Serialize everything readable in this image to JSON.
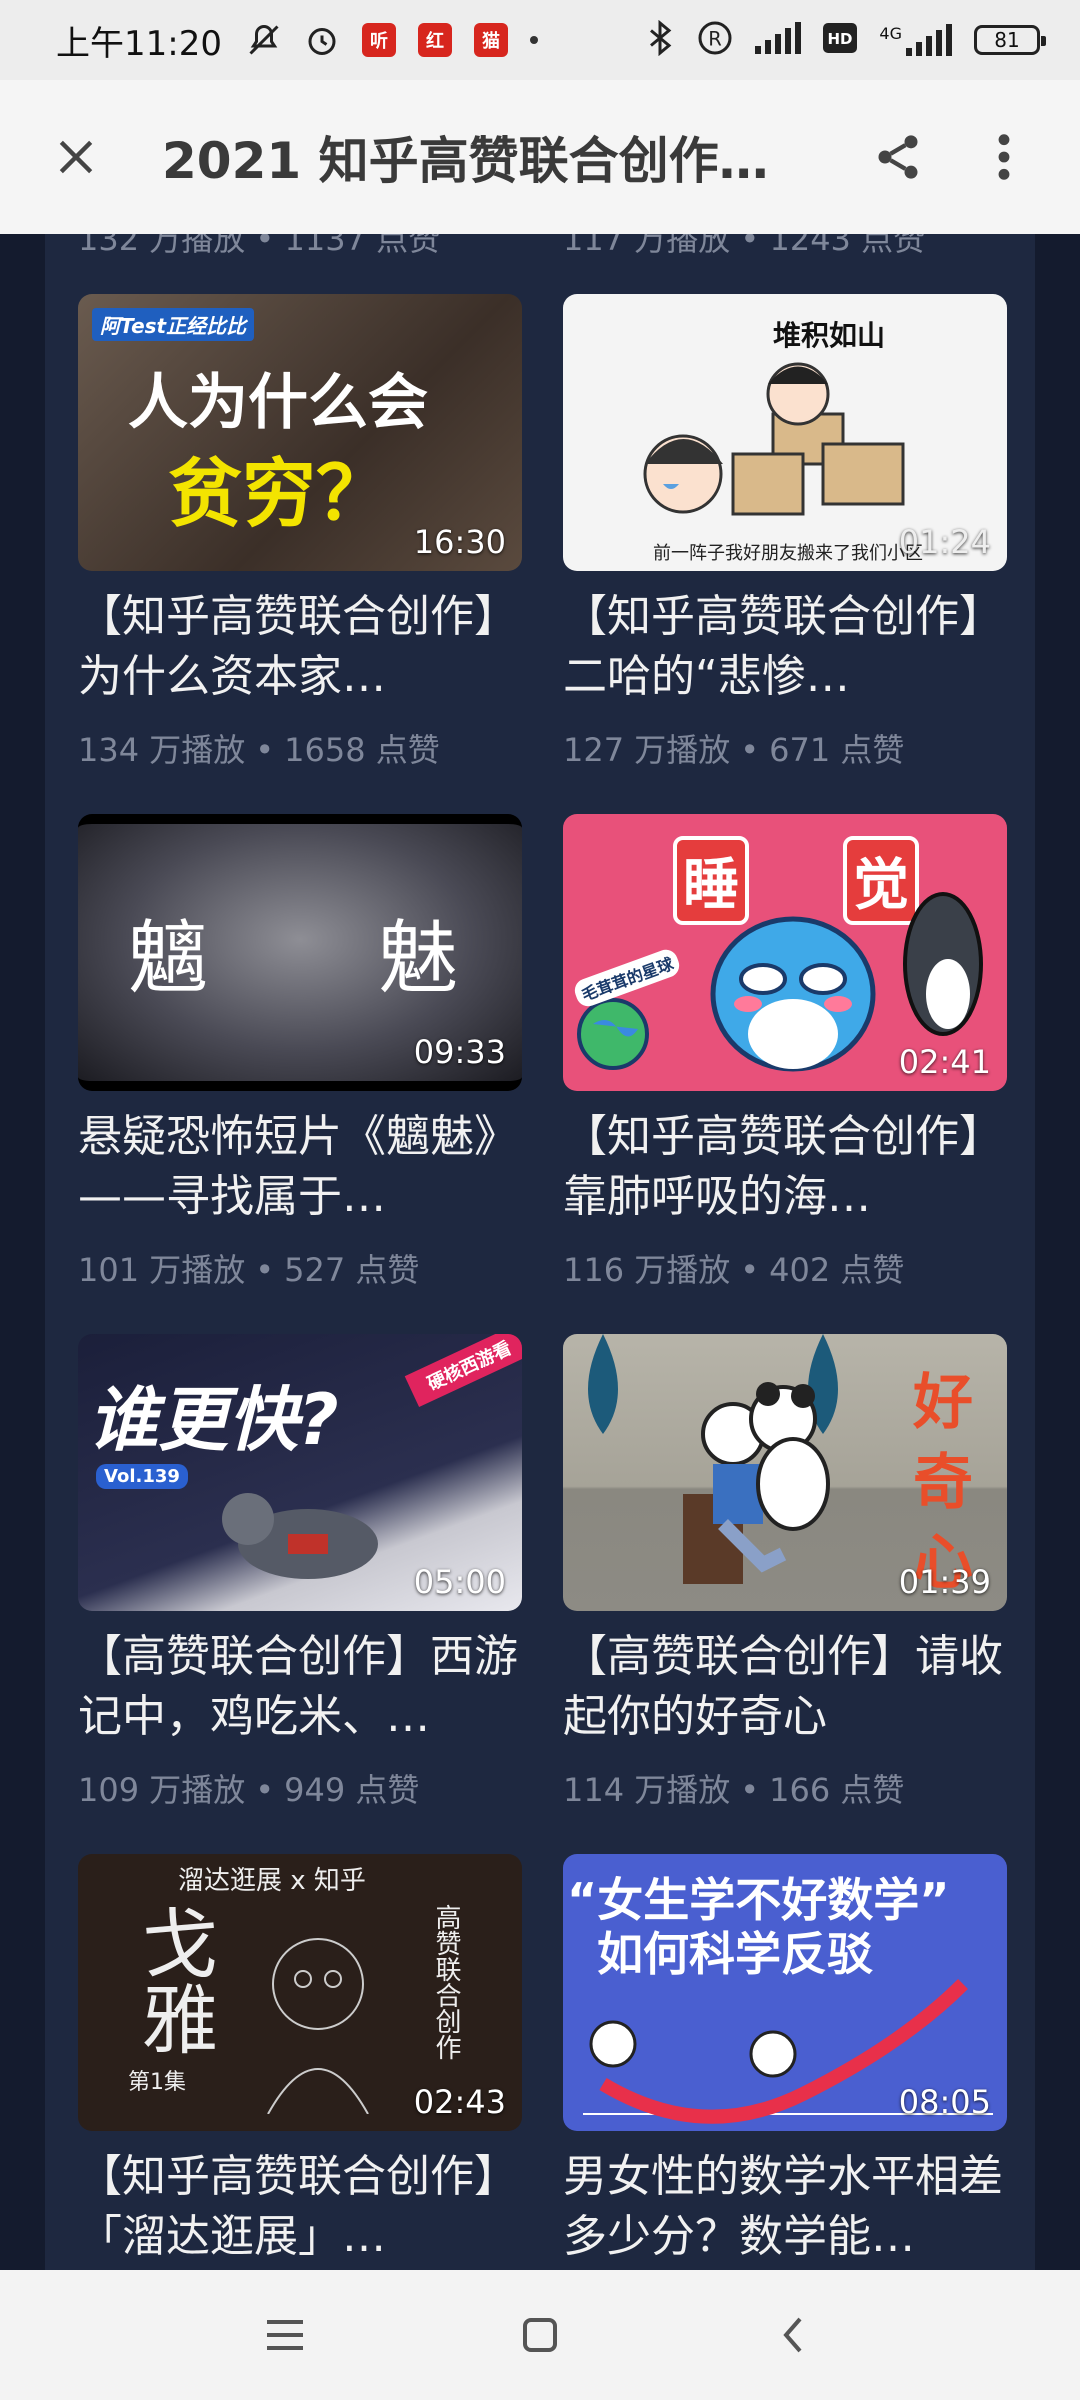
{
  "status_bar": {
    "time": "上午11:20",
    "app_icons": [
      "听",
      "红",
      "猫"
    ],
    "network": "4G",
    "battery": "81"
  },
  "app_bar": {
    "title": "2021 知乎高赞联合创作…"
  },
  "previous_row": {
    "left_meta": "132 万播放 • 1137 点赞",
    "right_meta": "117 万播放 • 1243 点赞"
  },
  "videos": [
    {
      "title": "【知乎高赞联合创作】为什么资本家…",
      "plays": "134 万播放",
      "likes": "1658 点赞",
      "duration": "16:30",
      "thumb_text": [
        "阿Test正经比比",
        "人为什么会",
        "贫穷？"
      ]
    },
    {
      "title": "【知乎高赞联合创作】二哈的“悲惨…",
      "plays": "127 万播放",
      "likes": "671 点赞",
      "duration": "01:24",
      "thumb_text": [
        "堆积如山",
        "前一阵子我好朋友搬来了我们小区"
      ]
    },
    {
      "title": "悬疑恐怖短片《魑魅》——寻找属于…",
      "plays": "101 万播放",
      "likes": "527 点赞",
      "duration": "09:33",
      "thumb_text": [
        "魑",
        "魅"
      ]
    },
    {
      "title": "【知乎高赞联合创作】靠肺呼吸的海…",
      "plays": "116 万播放",
      "likes": "402 点赞",
      "duration": "02:41",
      "thumb_text": [
        "睡",
        "觉",
        "毛茸茸的星球"
      ]
    },
    {
      "title": "【高赞联合创作】西游记中，鸡吃米、…",
      "plays": "109 万播放",
      "likes": "949 点赞",
      "duration": "05:00",
      "thumb_text": [
        "谁更快?",
        "Vol.139",
        "硬核西游看"
      ]
    },
    {
      "title": "【高赞联合创作】请收起你的好奇心",
      "plays": "114 万播放",
      "likes": "166 点赞",
      "duration": "01:39",
      "thumb_text": [
        "好",
        "奇",
        "心"
      ]
    },
    {
      "title": "【知乎高赞联合创作】「溜达逛展」…",
      "plays": "",
      "likes": "",
      "duration": "02:43",
      "thumb_text": [
        "溜达逛展 x 知乎",
        "戈雅",
        "第1集",
        "高赞联合创作"
      ]
    },
    {
      "title": "男女性的数学水平相差多少分？数学能…",
      "plays": "",
      "likes": "",
      "duration": "08:05",
      "thumb_text": [
        "“女生学不好数学”",
        "如何科学反驳"
      ]
    }
  ],
  "colors": {
    "page_bg": "#141b2e",
    "panel_bg": "#1e2840",
    "title_text": "#f1f1f1",
    "meta_text": "#7f879a"
  },
  "icons": {
    "close": "close-icon",
    "share": "share-icon",
    "more": "more-vertical-icon",
    "nav_menu": "menu-icon",
    "nav_home": "home-square-icon",
    "nav_back": "back-chevron-icon"
  }
}
